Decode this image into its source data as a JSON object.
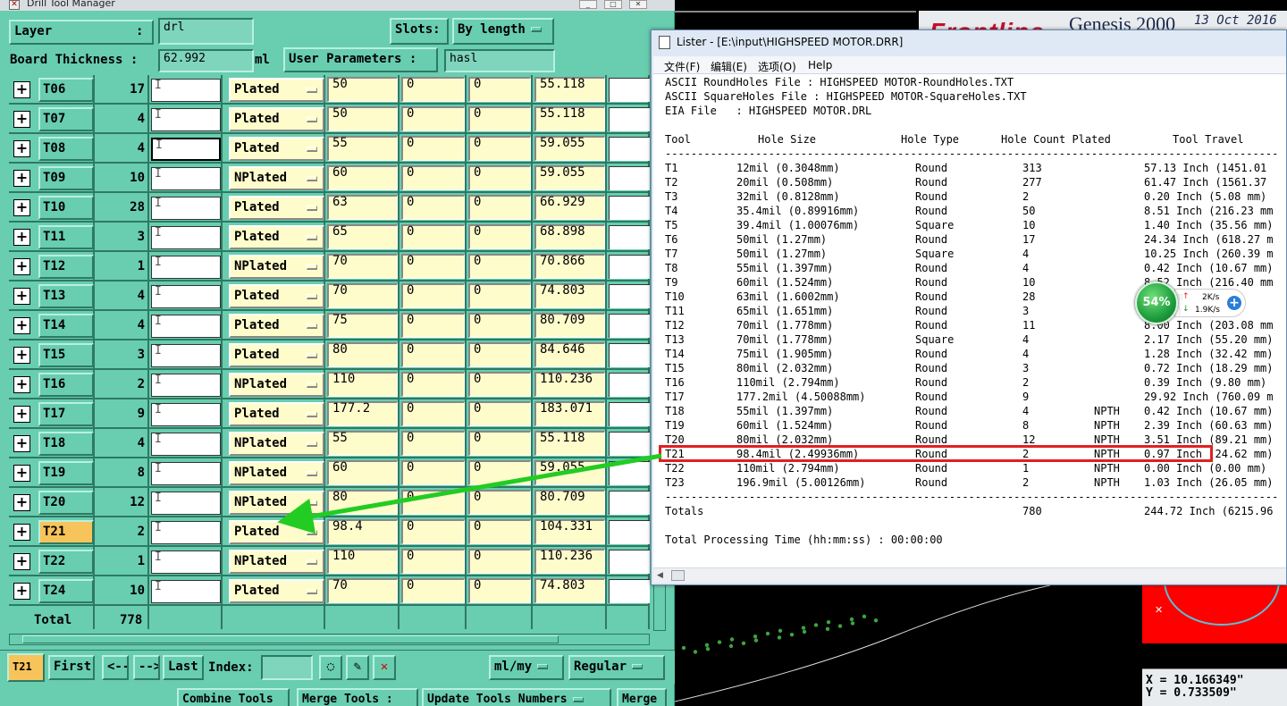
{
  "drill_tool_manager": {
    "window_title": "Drill Tool Manager",
    "layer_label": "Layer",
    "layer_colon": ":",
    "layer_value": "drl",
    "slots_label": "Slots:",
    "slots_value": "By length",
    "board_thickness_label": "Board Thickness :",
    "board_thickness_value": "62.992",
    "board_thickness_unit": "ml",
    "user_params_label": "User Parameters :",
    "user_params_value": "hasl",
    "rows": [
      {
        "tool": "T06",
        "count": "17",
        "type": "Plated",
        "size": "50",
        "p1": "0",
        "p2": "0",
        "finish": "55.118"
      },
      {
        "tool": "T07",
        "count": "4",
        "type": "Plated",
        "size": "50",
        "p1": "0",
        "p2": "0",
        "finish": "55.118"
      },
      {
        "tool": "T08",
        "count": "4",
        "type": "Plated",
        "size": "55",
        "p1": "0",
        "p2": "0",
        "finish": "59.055"
      },
      {
        "tool": "T09",
        "count": "10",
        "type": "NPlated",
        "size": "60",
        "p1": "0",
        "p2": "0",
        "finish": "59.055"
      },
      {
        "tool": "T10",
        "count": "28",
        "type": "Plated",
        "size": "63",
        "p1": "0",
        "p2": "0",
        "finish": "66.929"
      },
      {
        "tool": "T11",
        "count": "3",
        "type": "Plated",
        "size": "65",
        "p1": "0",
        "p2": "0",
        "finish": "68.898"
      },
      {
        "tool": "T12",
        "count": "1",
        "type": "NPlated",
        "size": "70",
        "p1": "0",
        "p2": "0",
        "finish": "70.866"
      },
      {
        "tool": "T13",
        "count": "4",
        "type": "Plated",
        "size": "70",
        "p1": "0",
        "p2": "0",
        "finish": "74.803"
      },
      {
        "tool": "T14",
        "count": "4",
        "type": "Plated",
        "size": "75",
        "p1": "0",
        "p2": "0",
        "finish": "80.709"
      },
      {
        "tool": "T15",
        "count": "3",
        "type": "Plated",
        "size": "80",
        "p1": "0",
        "p2": "0",
        "finish": "84.646"
      },
      {
        "tool": "T16",
        "count": "2",
        "type": "NPlated",
        "size": "110",
        "p1": "0",
        "p2": "0",
        "finish": "110.236"
      },
      {
        "tool": "T17",
        "count": "9",
        "type": "Plated",
        "size": "177.2",
        "p1": "0",
        "p2": "0",
        "finish": "183.071"
      },
      {
        "tool": "T18",
        "count": "4",
        "type": "NPlated",
        "size": "55",
        "p1": "0",
        "p2": "0",
        "finish": "55.118"
      },
      {
        "tool": "T19",
        "count": "8",
        "type": "NPlated",
        "size": "60",
        "p1": "0",
        "p2": "0",
        "finish": "59.055"
      },
      {
        "tool": "T20",
        "count": "12",
        "type": "NPlated",
        "size": "80",
        "p1": "0",
        "p2": "0",
        "finish": "80.709"
      },
      {
        "tool": "T21",
        "count": "2",
        "type": "Plated",
        "size": "98.4",
        "p1": "0",
        "p2": "0",
        "finish": "104.331"
      },
      {
        "tool": "T22",
        "count": "1",
        "type": "NPlated",
        "size": "110",
        "p1": "0",
        "p2": "0",
        "finish": "110.236"
      },
      {
        "tool": "T24",
        "count": "10",
        "type": "Plated",
        "size": "70",
        "p1": "0",
        "p2": "0",
        "finish": "74.803"
      }
    ],
    "selected_tool": "T21",
    "total_label": "Total",
    "total_value": "778",
    "nav": {
      "current": "T21",
      "first": "First",
      "prev": "<--",
      "next": "-->",
      "last": "Last",
      "index_label": "Index:",
      "units": "ml/my",
      "mode": "Regular"
    },
    "bottom_buttons": {
      "combine": "Combine Tools",
      "merge_label": "Merge Tools :",
      "update": "Update Tools Numbers",
      "merge": "Merge"
    }
  },
  "lister": {
    "title": "Lister - [E:\\input\\HIGHSPEED MOTOR.DRR]",
    "menu": [
      "文件(F)",
      "编辑(E)",
      "选项(O)",
      "Help"
    ],
    "header_lines": [
      "ASCII RoundHoles File : HIGHSPEED MOTOR-RoundHoles.TXT",
      "ASCII SquareHoles File : HIGHSPEED MOTOR-SquareHoles.TXT",
      "EIA File   : HIGHSPEED MOTOR.DRL"
    ],
    "columns": [
      "Tool",
      "Hole Size",
      "Hole Type",
      "Hole Count Plated",
      "Tool Travel"
    ],
    "rows": [
      {
        "tool": "T1",
        "size": "12mil (0.3048mm)",
        "type": "Round",
        "count": "313",
        "plated": "",
        "travel": "57.13 Inch (1451.01"
      },
      {
        "tool": "T2",
        "size": "20mil (0.508mm)",
        "type": "Round",
        "count": "277",
        "plated": "",
        "travel": "61.47 Inch (1561.37"
      },
      {
        "tool": "T3",
        "size": "32mil (0.8128mm)",
        "type": "Round",
        "count": "2",
        "plated": "",
        "travel": "0.20 Inch (5.08 mm)"
      },
      {
        "tool": "T4",
        "size": "35.4mil (0.89916mm)",
        "type": "Round",
        "count": "50",
        "plated": "",
        "travel": "8.51 Inch (216.23 mm"
      },
      {
        "tool": "T5",
        "size": "39.4mil (1.00076mm)",
        "type": "Square",
        "count": "10",
        "plated": "",
        "travel": "1.40 Inch (35.56 mm)"
      },
      {
        "tool": "T6",
        "size": "50mil (1.27mm)",
        "type": "Round",
        "count": "17",
        "plated": "",
        "travel": "24.34 Inch (618.27 m"
      },
      {
        "tool": "T7",
        "size": "50mil (1.27mm)",
        "type": "Square",
        "count": "4",
        "plated": "",
        "travel": "10.25 Inch (260.39 m"
      },
      {
        "tool": "T8",
        "size": "55mil (1.397mm)",
        "type": "Round",
        "count": "4",
        "plated": "",
        "travel": "0.42 Inch (10.67 mm)"
      },
      {
        "tool": "T9",
        "size": "60mil (1.524mm)",
        "type": "Round",
        "count": "10",
        "plated": "",
        "travel": "8.52 Inch (216.40 mm"
      },
      {
        "tool": "T10",
        "size": "63mil (1.6002mm)",
        "type": "Round",
        "count": "28",
        "plated": "",
        "travel": "5.71 m"
      },
      {
        "tool": "T11",
        "size": "65mil (1.651mm)",
        "type": "Round",
        "count": "3",
        "plated": "",
        "travel": "24 mm)"
      },
      {
        "tool": "T12",
        "size": "70mil (1.778mm)",
        "type": "Round",
        "count": "11",
        "plated": "",
        "travel": "8.00 Inch (203.08 mm"
      },
      {
        "tool": "T13",
        "size": "70mil (1.778mm)",
        "type": "Square",
        "count": "4",
        "plated": "",
        "travel": "2.17 Inch (55.20 mm)"
      },
      {
        "tool": "T14",
        "size": "75mil (1.905mm)",
        "type": "Round",
        "count": "4",
        "plated": "",
        "travel": "1.28 Inch (32.42 mm)"
      },
      {
        "tool": "T15",
        "size": "80mil (2.032mm)",
        "type": "Round",
        "count": "3",
        "plated": "",
        "travel": "0.72 Inch (18.29 mm)"
      },
      {
        "tool": "T16",
        "size": "110mil (2.794mm)",
        "type": "Round",
        "count": "2",
        "plated": "",
        "travel": "0.39 Inch (9.80 mm)"
      },
      {
        "tool": "T17",
        "size": "177.2mil (4.50088mm)",
        "type": "Round",
        "count": "9",
        "plated": "",
        "travel": "29.92 Inch (760.09 m"
      },
      {
        "tool": "T18",
        "size": "55mil (1.397mm)",
        "type": "Round",
        "count": "4",
        "plated": "NPTH",
        "travel": "0.42 Inch (10.67 mm)"
      },
      {
        "tool": "T19",
        "size": "60mil (1.524mm)",
        "type": "Round",
        "count": "8",
        "plated": "NPTH",
        "travel": "2.39 Inch (60.63 mm)"
      },
      {
        "tool": "T20",
        "size": "80mil (2.032mm)",
        "type": "Round",
        "count": "12",
        "plated": "NPTH",
        "travel": "3.51 Inch (89.21 mm)"
      },
      {
        "tool": "T21",
        "size": "98.4mil (2.49936mm)",
        "type": "Round",
        "count": "2",
        "plated": "NPTH",
        "travel": "0.97 Inch (24.62 mm)"
      },
      {
        "tool": "T22",
        "size": "110mil (2.794mm)",
        "type": "Round",
        "count": "1",
        "plated": "NPTH",
        "travel": "0.00 Inch (0.00 mm)"
      },
      {
        "tool": "T23",
        "size": "196.9mil (5.00126mm)",
        "type": "Round",
        "count": "2",
        "plated": "NPTH",
        "travel": "1.03 Inch (26.05 mm)"
      }
    ],
    "separator": "-----------------------------------------------------------------------------------------------",
    "totals_label": "Totals",
    "totals_count": "780",
    "totals_travel": "244.72 Inch (6215.96",
    "processing": "Total Processing Time (hh:mm:ss) : 00:00:00"
  },
  "widget": {
    "percent": "54%",
    "up": "2K/s",
    "down": "1.9K/s"
  },
  "genesis": {
    "logo": "Frontline",
    "title": "Genesis 2000",
    "date": "13 Oct 2016",
    "coord_x": "X = 10.166349\"",
    "coord_y": "Y = 0.733509\""
  },
  "colors": {
    "panel": "#69cdb0",
    "cell_yellow": "#fffccc",
    "selected_tool": "#f7c45b",
    "highlight": "#e02020",
    "arrow": "#22cc22"
  }
}
